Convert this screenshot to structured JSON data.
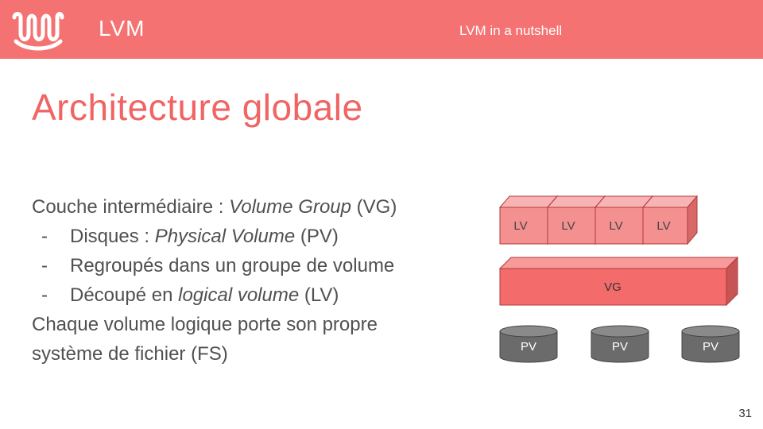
{
  "header": {
    "logo_icon": "wave-logo-icon",
    "title": "LVM",
    "subtitle": "LVM in a nutshell",
    "background": "#f47272"
  },
  "slide": {
    "title": "Architecture globale",
    "page_number": "31"
  },
  "content": {
    "line1": {
      "prefix": "Couche intermédiaire : ",
      "emph": "Volume Group",
      "suffix": " (VG)"
    },
    "bullets": [
      {
        "marker": "-",
        "prefix": "Disques : ",
        "emph": "Physical Volume",
        "suffix": " (PV)"
      },
      {
        "marker": "-",
        "prefix": "Regroupés dans un groupe de volume",
        "emph": "",
        "suffix": ""
      },
      {
        "marker": "-",
        "prefix": "Découpé en ",
        "emph": "logical volume",
        "suffix": " (LV)"
      }
    ],
    "line5": "Chaque volume logique porte son propre",
    "line6": "système de fichier (FS)"
  },
  "diagram": {
    "lv_labels": [
      "LV",
      "LV",
      "LV",
      "LV"
    ],
    "vg_label": "VG",
    "pv_labels": [
      "PV",
      "PV",
      "PV"
    ],
    "colors": {
      "lv": "#f49090",
      "vg": "#f46b6b",
      "pv": "#6b6b6b"
    }
  }
}
